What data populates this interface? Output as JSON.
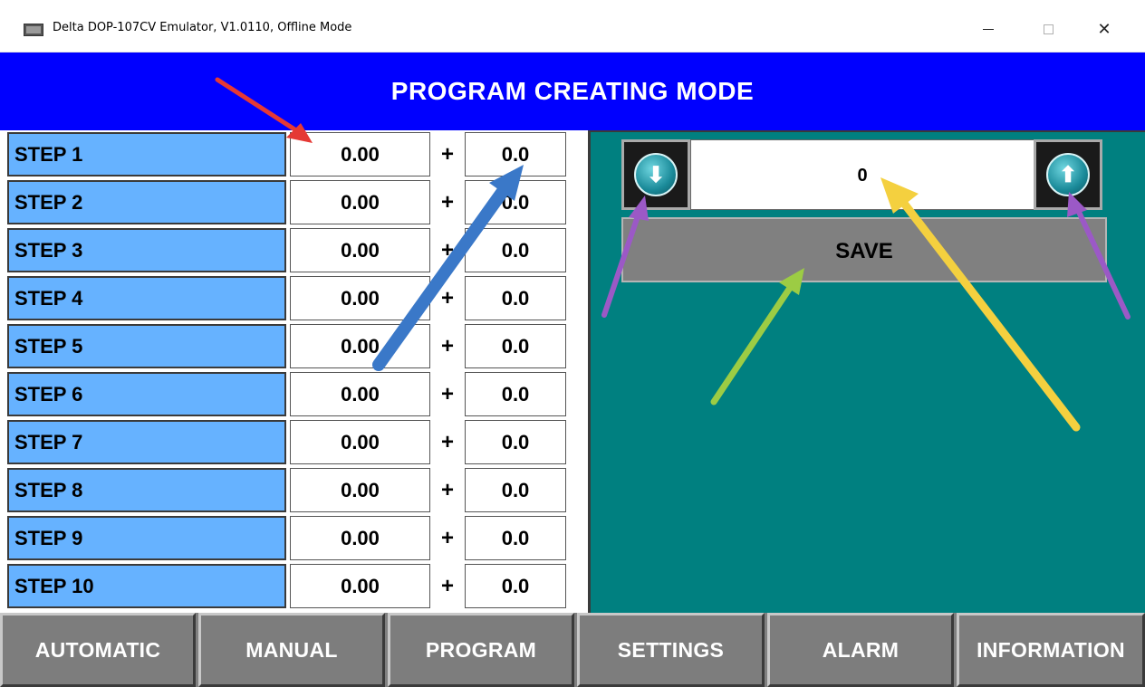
{
  "window": {
    "title": "Delta DOP-107CV Emulator, V1.0110, Offline Mode",
    "minimize_symbol": "",
    "maximize_symbol": "",
    "close_symbol": "✕"
  },
  "header": {
    "title": "PROGRAM CREATING MODE"
  },
  "steps": [
    {
      "label": "STEP 1",
      "value": "0.00",
      "operator": "+",
      "offset": "0.0"
    },
    {
      "label": "STEP 2",
      "value": "0.00",
      "operator": "+",
      "offset": "0.0"
    },
    {
      "label": "STEP 3",
      "value": "0.00",
      "operator": "+",
      "offset": "0.0"
    },
    {
      "label": "STEP 4",
      "value": "0.00",
      "operator": "+",
      "offset": "0.0"
    },
    {
      "label": "STEP 5",
      "value": "0.00",
      "operator": "+",
      "offset": "0.0"
    },
    {
      "label": "STEP 6",
      "value": "0.00",
      "operator": "+",
      "offset": "0.0"
    },
    {
      "label": "STEP 7",
      "value": "0.00",
      "operator": "+",
      "offset": "0.0"
    },
    {
      "label": "STEP 8",
      "value": "0.00",
      "operator": "+",
      "offset": "0.0"
    },
    {
      "label": "STEP 9",
      "value": "0.00",
      "operator": "+",
      "offset": "0.0"
    },
    {
      "label": "STEP 10",
      "value": "0.00",
      "operator": "+",
      "offset": "0.0"
    }
  ],
  "program_panel": {
    "counter_value": "0",
    "save_label": "SAVE",
    "down_icon": "arrow-down-circle-icon",
    "up_icon": "arrow-up-circle-icon",
    "down_glyph": "⬇",
    "up_glyph": "⬆"
  },
  "nav": {
    "items": [
      {
        "label": "AUTOMATIC"
      },
      {
        "label": "MANUAL"
      },
      {
        "label": "PROGRAM"
      },
      {
        "label": "SETTINGS"
      },
      {
        "label": "ALARM"
      },
      {
        "label": "INFORMATION"
      }
    ]
  },
  "colors": {
    "header_bg": "#0000ff",
    "step_label_bg": "#66b2ff",
    "panel_bg": "#008080",
    "nav_bg": "#808080",
    "annotation_red": "#e53935",
    "annotation_blue": "#3a78c8",
    "annotation_purple": "#9b59c6",
    "annotation_green": "#9ccc44",
    "annotation_yellow": "#f4d03f"
  }
}
